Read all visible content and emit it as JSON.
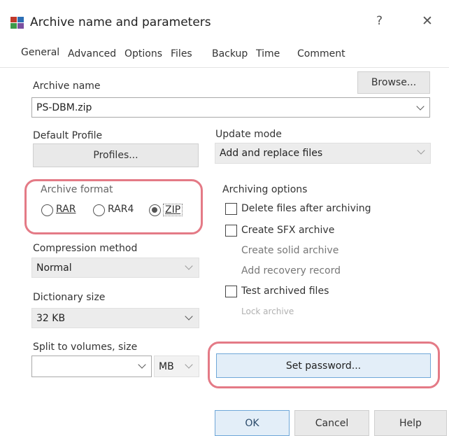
{
  "window": {
    "title": "Archive name and parameters",
    "help_glyph": "?",
    "close_glyph": "✕"
  },
  "tabs": [
    "General",
    "Advanced",
    "Options",
    "Files",
    "Backup",
    "Time",
    "Comment"
  ],
  "archive_name": {
    "label": "Archive name",
    "value": "PS-DBM.zip",
    "browse_label": "Browse..."
  },
  "default_profile": {
    "label": "Default Profile",
    "button_label": "Profiles..."
  },
  "update_mode": {
    "label": "Update mode",
    "value": "Add and replace files"
  },
  "archive_format": {
    "label": "Archive format",
    "options": [
      "RAR",
      "RAR4",
      "ZIP"
    ],
    "selected": "ZIP"
  },
  "compression_method": {
    "label": "Compression method",
    "value": "Normal"
  },
  "dictionary_size": {
    "label": "Dictionary size",
    "value": "32 KB"
  },
  "split_volumes": {
    "label": "Split to volumes, size",
    "value": "",
    "unit": "MB"
  },
  "archiving_options": {
    "label": "Archiving options",
    "delete_after": "Delete files after archiving",
    "create_sfx": "Create SFX archive",
    "create_solid": "Create solid archive",
    "add_recovery": "Add recovery record",
    "test_files": "Test archived files",
    "lock_archive": "Lock archive"
  },
  "set_password_label": "Set password...",
  "footer": {
    "ok": "OK",
    "cancel": "Cancel",
    "help": "Help"
  },
  "colors": {
    "highlight_outline": "#e47a86",
    "primary_button_border": "#6fa7d8"
  }
}
